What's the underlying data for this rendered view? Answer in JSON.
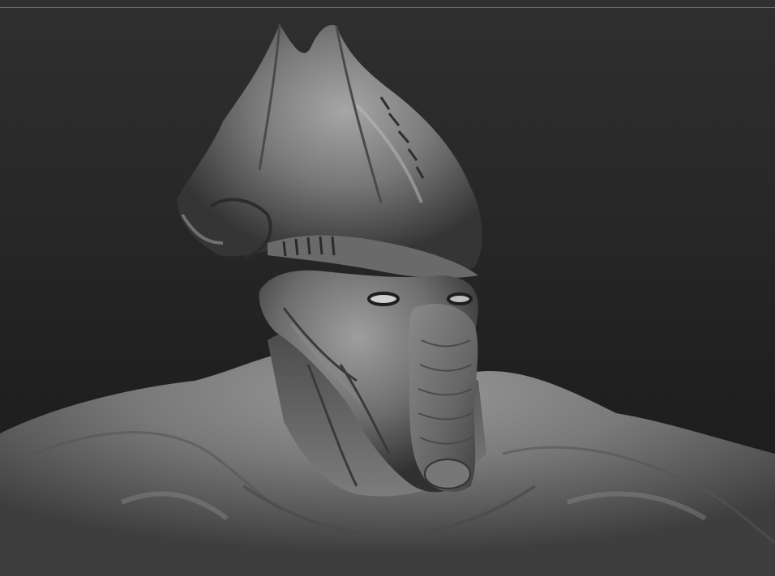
{
  "viewport": {
    "background_top": "#2f2f2f",
    "background_bottom": "#1b1b1b",
    "divider_color": "#7a7a7a"
  },
  "model": {
    "material_light": "#a9a9a9",
    "material_mid": "#6f6f6f",
    "material_dark": "#262626",
    "icon": "sculpt-render"
  }
}
